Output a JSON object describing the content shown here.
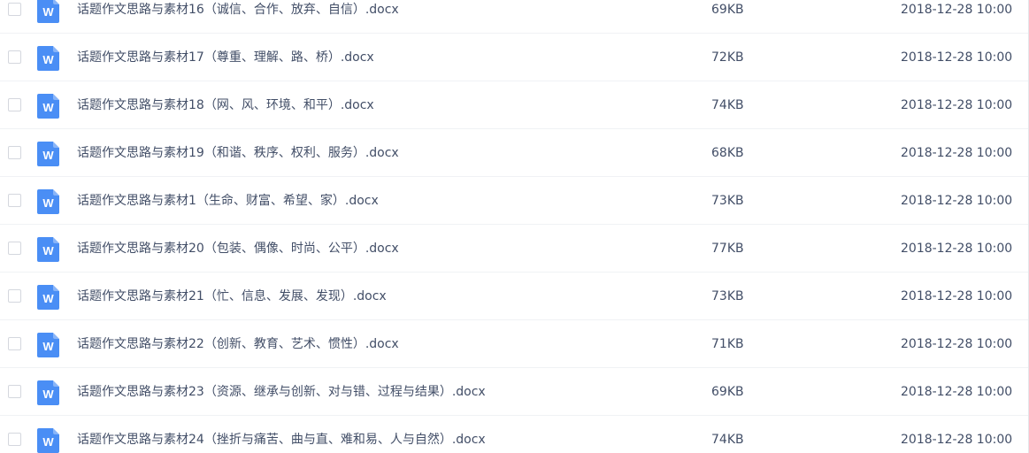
{
  "icons": {
    "file_type": "word-document-icon",
    "letter": "W",
    "color": "#4a8ef5"
  },
  "files": [
    {
      "name": "话题作文思路与素材16（诚信、合作、放弃、自信）.docx",
      "size": "69KB",
      "modified": "2018-12-28 10:00"
    },
    {
      "name": "话题作文思路与素材17（尊重、理解、路、桥）.docx",
      "size": "72KB",
      "modified": "2018-12-28 10:00"
    },
    {
      "name": "话题作文思路与素材18（网、风、环境、和平）.docx",
      "size": "74KB",
      "modified": "2018-12-28 10:00"
    },
    {
      "name": "话题作文思路与素材19（和谐、秩序、权利、服务）.docx",
      "size": "68KB",
      "modified": "2018-12-28 10:00"
    },
    {
      "name": "话题作文思路与素材1（生命、财富、希望、家）.docx",
      "size": "73KB",
      "modified": "2018-12-28 10:00"
    },
    {
      "name": "话题作文思路与素材20（包装、偶像、时尚、公平）.docx",
      "size": "77KB",
      "modified": "2018-12-28 10:00"
    },
    {
      "name": "话题作文思路与素材21（忙、信息、发展、发现）.docx",
      "size": "73KB",
      "modified": "2018-12-28 10:00"
    },
    {
      "name": "话题作文思路与素材22（创新、教育、艺术、惯性）.docx",
      "size": "71KB",
      "modified": "2018-12-28 10:00"
    },
    {
      "name": "话题作文思路与素材23（资源、继承与创新、对与错、过程与结果）.docx",
      "size": "69KB",
      "modified": "2018-12-28 10:00"
    },
    {
      "name": "话题作文思路与素材24（挫折与痛苦、曲与直、难和易、人与自然）.docx",
      "size": "74KB",
      "modified": "2018-12-28 10:00"
    }
  ]
}
